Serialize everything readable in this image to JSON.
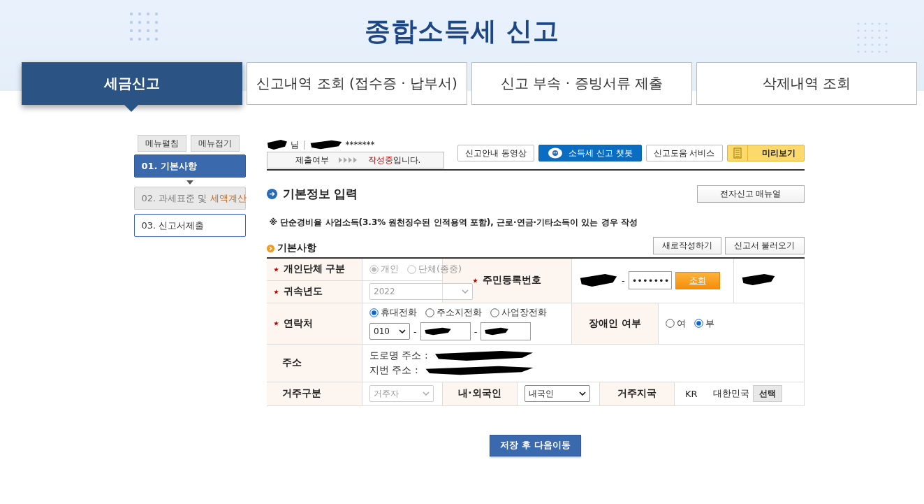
{
  "header": {
    "title": "종합소득세 신고"
  },
  "tabs": [
    {
      "label": "세금신고",
      "selected": true
    },
    {
      "label": "신고내역 조회 (접수증 · 납부서)",
      "selected": false
    },
    {
      "label": "신고 부속 · 증빙서류 제출",
      "selected": false
    },
    {
      "label": "삭제내역 조회",
      "selected": false
    }
  ],
  "sidebar": {
    "buttons": [
      "메뉴펼침",
      "메뉴접기"
    ],
    "steps": [
      {
        "text": "01. 기본사항",
        "selected": true,
        "disabled": false
      },
      {
        "text": "02. 과세표준 및 ",
        "accent": "세액계산",
        "selected": false,
        "disabled": true
      },
      {
        "text": "03. 신고서제출",
        "selected": false,
        "disabled": false
      }
    ]
  },
  "user": {
    "suffix": "님",
    "masked": "*******"
  },
  "status": {
    "label": "제출여부",
    "value": "작성중",
    "suffix": "입니다."
  },
  "top_buttons": [
    {
      "label": "신고안내 동영상",
      "kind": "plain"
    },
    {
      "label": "소득세 신고 챗봇",
      "kind": "chatbot"
    },
    {
      "label": "신고도움 서비스",
      "kind": "plain"
    },
    {
      "label": "미리보기",
      "kind": "preview"
    }
  ],
  "section": {
    "title": "기본정보 입력",
    "manual_button": "전자신고 매뉴얼",
    "notice": "※ 단순경비율 사업소득(3.3% 원천징수된 인적용역 포함), 근로·연금·기타소득이 있는 경우 작성"
  },
  "subsection": {
    "title": "기본사항",
    "buttons": [
      "새로작성하기",
      "신고서 불러오기"
    ]
  },
  "form": {
    "person_type": {
      "label": "개인단체 구분",
      "required": true,
      "disabled": true,
      "options": [
        {
          "label": "개인",
          "selected": true
        },
        {
          "label": "단체(종중)",
          "selected": false
        }
      ]
    },
    "year": {
      "label": "귀속년도",
      "required": true,
      "disabled": true,
      "value": "2022"
    },
    "rrn": {
      "label": "주민등록번호",
      "required": true,
      "separator": "-",
      "masked": "•••••••",
      "button": "조회"
    },
    "contact": {
      "label": "연락처",
      "required": true,
      "prefix": "010",
      "separators": [
        "-",
        "-"
      ],
      "options": [
        {
          "label": "휴대전화",
          "selected": true
        },
        {
          "label": "주소지전화",
          "selected": false
        },
        {
          "label": "사업장전화",
          "selected": false
        }
      ]
    },
    "disability": {
      "label": "장애인 여부",
      "required": false,
      "options": [
        {
          "label": "여",
          "selected": false
        },
        {
          "label": "부",
          "selected": true
        }
      ]
    },
    "address": {
      "label": "주소",
      "required": false,
      "road_label": "도로명 주소 :",
      "lot_label": "지번 주소 :"
    },
    "residence": {
      "label": "거주구분",
      "required": false,
      "disabled": true,
      "value": "거주자"
    },
    "nationality": {
      "label": "내·외국인",
      "required": false,
      "disabled": false,
      "value": "내국인"
    },
    "country": {
      "label": "거주지국",
      "required": false,
      "code": "KR",
      "name": "대한민국",
      "button": "선택"
    }
  },
  "submit": "저장 후 다음이동"
}
